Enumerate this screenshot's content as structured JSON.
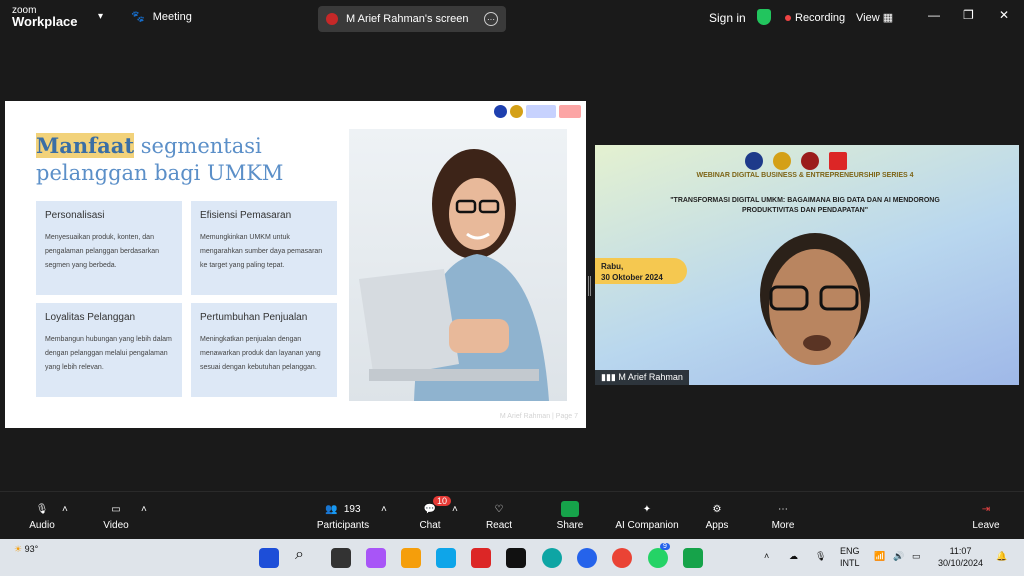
{
  "app": {
    "logo_line1": "zoom",
    "logo_line2": "Workplace"
  },
  "topbar": {
    "meeting_label": "Meeting",
    "screen_label": "M Arief Rahman's screen",
    "signin": "Sign in",
    "recording": "Recording",
    "view": "View"
  },
  "slide": {
    "title_highlight": "Manfaat",
    "title_rest": " segmentasi pelanggan bagi UMKM",
    "cards": [
      {
        "h": "Personalisasi",
        "b": "Menyesuaikan produk, konten, dan pengalaman pelanggan berdasarkan segmen yang berbeda."
      },
      {
        "h": "Efisiensi Pemasaran",
        "b": "Memungkinkan UMKM untuk mengarahkan sumber daya pemasaran ke target yang paling tepat."
      },
      {
        "h": "Loyalitas Pelanggan",
        "b": "Membangun hubungan yang lebih dalam dengan pelanggan melalui pengalaman yang lebih relevan."
      },
      {
        "h": "Pertumbuhan Penjualan",
        "b": "Meningkatkan penjualan dengan menawarkan produk dan layanan yang sesuai dengan kebutuhan pelanggan."
      }
    ],
    "footer": "M Arief Rahman | Page 7"
  },
  "video": {
    "banner": "WEBINAR DIGITAL BUSINESS & ENTREPRENEURSHIP SERIES 4",
    "title": "\"TRANSFORMASI DIGITAL UMKM: BAGAIMANA BIG DATA DAN AI MENDORONG PRODUKTIVITAS DAN PENDAPATAN\"",
    "date_line1": "Rabu,",
    "date_line2": "30 Oktober 2024",
    "name": "M Arief Rahman"
  },
  "controls": {
    "audio": "Audio",
    "video": "Video",
    "participants": "Participants",
    "participants_count": "193",
    "chat": "Chat",
    "chat_badge": "10",
    "react": "React",
    "share": "Share",
    "ai": "AI Companion",
    "apps": "Apps",
    "more": "More",
    "leave": "Leave"
  },
  "taskbar": {
    "temp": "93°",
    "lang1": "ENG",
    "lang2": "INTL",
    "time": "11:07",
    "date": "30/10/2024",
    "whatsapp_badge": "9"
  },
  "colors": {
    "accent": "#5b8fc8",
    "card": "#dde8f6",
    "recording": "#ef4444",
    "share": "#16a34a"
  }
}
